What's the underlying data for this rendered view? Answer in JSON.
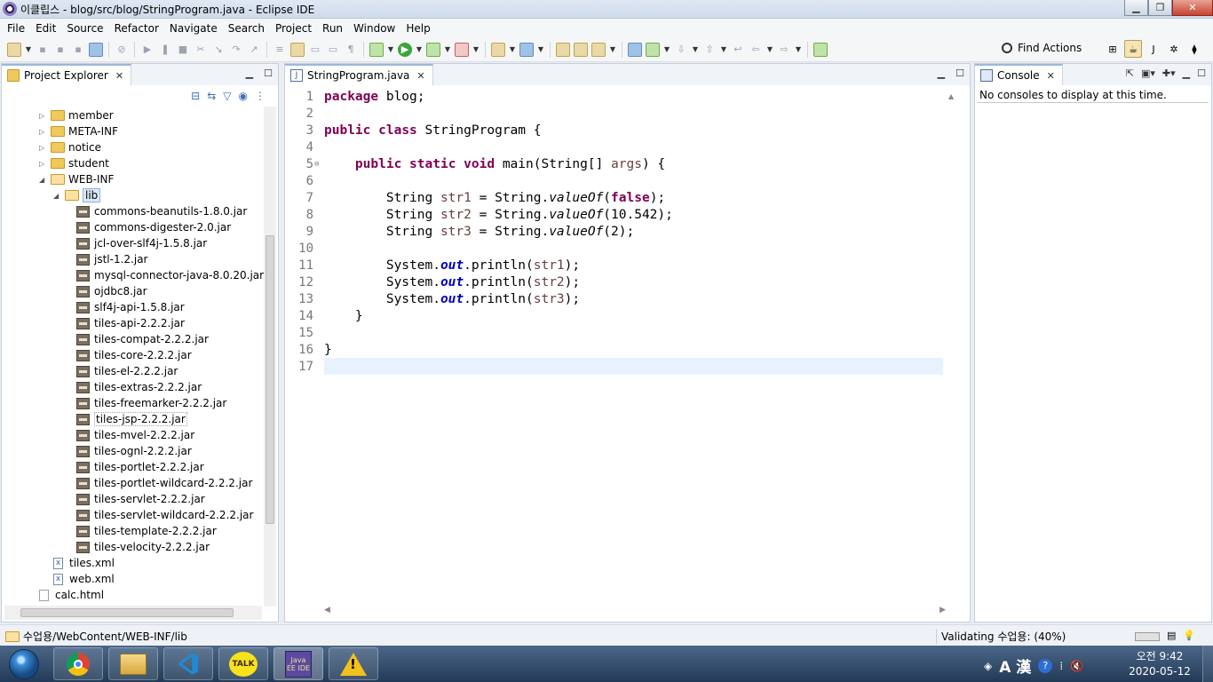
{
  "window": {
    "title": "이클립스 - blog/src/blog/StringProgram.java - Eclipse IDE"
  },
  "menu": [
    "File",
    "Edit",
    "Source",
    "Refactor",
    "Navigate",
    "Search",
    "Project",
    "Run",
    "Window",
    "Help"
  ],
  "toolbar": {
    "find_actions": "Find Actions"
  },
  "explorer": {
    "tab_label": "Project Explorer",
    "items": [
      {
        "label": "member",
        "indent": 1,
        "type": "folder",
        "expanded": false
      },
      {
        "label": "META-INF",
        "indent": 1,
        "type": "folder",
        "expanded": false
      },
      {
        "label": "notice",
        "indent": 1,
        "type": "folder",
        "expanded": false
      },
      {
        "label": "student",
        "indent": 1,
        "type": "folder",
        "expanded": false
      },
      {
        "label": "WEB-INF",
        "indent": 1,
        "type": "folder",
        "expanded": true
      },
      {
        "label": "lib",
        "indent": 2,
        "type": "folder",
        "expanded": true,
        "selected": true
      },
      {
        "label": "commons-beanutils-1.8.0.jar",
        "indent": 3,
        "type": "jar"
      },
      {
        "label": "commons-digester-2.0.jar",
        "indent": 3,
        "type": "jar"
      },
      {
        "label": "jcl-over-slf4j-1.5.8.jar",
        "indent": 3,
        "type": "jar"
      },
      {
        "label": "jstl-1.2.jar",
        "indent": 3,
        "type": "jar"
      },
      {
        "label": "mysql-connector-java-8.0.20.jar",
        "indent": 3,
        "type": "jar"
      },
      {
        "label": "ojdbc8.jar",
        "indent": 3,
        "type": "jar"
      },
      {
        "label": "slf4j-api-1.5.8.jar",
        "indent": 3,
        "type": "jar"
      },
      {
        "label": "tiles-api-2.2.2.jar",
        "indent": 3,
        "type": "jar"
      },
      {
        "label": "tiles-compat-2.2.2.jar",
        "indent": 3,
        "type": "jar"
      },
      {
        "label": "tiles-core-2.2.2.jar",
        "indent": 3,
        "type": "jar"
      },
      {
        "label": "tiles-el-2.2.2.jar",
        "indent": 3,
        "type": "jar"
      },
      {
        "label": "tiles-extras-2.2.2.jar",
        "indent": 3,
        "type": "jar"
      },
      {
        "label": "tiles-freemarker-2.2.2.jar",
        "indent": 3,
        "type": "jar"
      },
      {
        "label": "tiles-jsp-2.2.2.jar",
        "indent": 3,
        "type": "jar",
        "hover": true
      },
      {
        "label": "tiles-mvel-2.2.2.jar",
        "indent": 3,
        "type": "jar"
      },
      {
        "label": "tiles-ognl-2.2.2.jar",
        "indent": 3,
        "type": "jar"
      },
      {
        "label": "tiles-portlet-2.2.2.jar",
        "indent": 3,
        "type": "jar"
      },
      {
        "label": "tiles-portlet-wildcard-2.2.2.jar",
        "indent": 3,
        "type": "jar"
      },
      {
        "label": "tiles-servlet-2.2.2.jar",
        "indent": 3,
        "type": "jar"
      },
      {
        "label": "tiles-servlet-wildcard-2.2.2.jar",
        "indent": 3,
        "type": "jar"
      },
      {
        "label": "tiles-template-2.2.2.jar",
        "indent": 3,
        "type": "jar"
      },
      {
        "label": "tiles-velocity-2.2.2.jar",
        "indent": 3,
        "type": "jar"
      },
      {
        "label": "tiles.xml",
        "indent": 2,
        "type": "xml"
      },
      {
        "label": "web.xml",
        "indent": 2,
        "type": "xml"
      },
      {
        "label": "calc.html",
        "indent": 1,
        "type": "html"
      }
    ]
  },
  "editor": {
    "tab_label": "StringProgram.java",
    "lines": [
      "package blog;",
      "",
      "public class StringProgram {",
      "",
      "    public static void main(String[] args) {",
      "",
      "        String str1 = String.valueOf(false);",
      "        String str2 = String.valueOf(10.542);",
      "        String str3 = String.valueOf(2);",
      "",
      "        System.out.println(str1);",
      "        System.out.println(str2);",
      "        System.out.println(str3);",
      "    }",
      "",
      "}",
      ""
    ],
    "current_line": 17
  },
  "console": {
    "tab_label": "Console",
    "message": "No consoles to display at this time."
  },
  "status": {
    "path": "수업용/WebContent/WEB-INF/lib",
    "validating": "Validating 수업용: (40%)"
  },
  "taskbar": {
    "apps": [
      "chrome",
      "file-explorer",
      "vscode",
      "kakaotalk",
      "eclipse",
      "warning"
    ],
    "eclipse_label": "Java EE IDE",
    "kakao_label": "TALK",
    "tray_lang": "A 漢",
    "time": "오전 9:42",
    "date": "2020-05-12"
  }
}
